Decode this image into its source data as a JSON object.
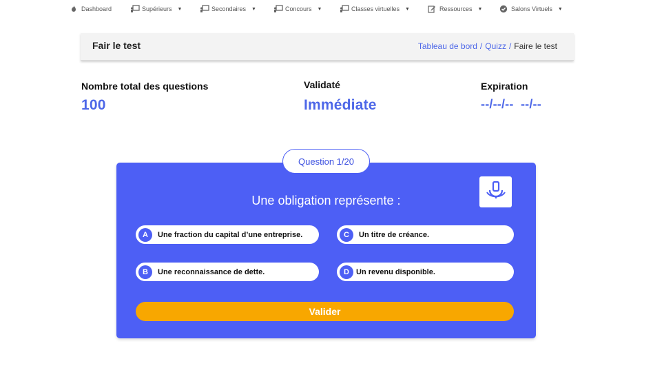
{
  "nav": {
    "items": [
      {
        "label": "Dashboard",
        "icon": "fire-icon",
        "has_caret": false
      },
      {
        "label": "Supérieurs",
        "icon": "presentation-icon",
        "has_caret": true
      },
      {
        "label": "Secondaires",
        "icon": "presentation-icon",
        "has_caret": true
      },
      {
        "label": "Concours",
        "icon": "presentation-icon",
        "has_caret": true
      },
      {
        "label": "Classes virtuelles",
        "icon": "presentation-icon",
        "has_caret": true
      },
      {
        "label": "Ressources",
        "icon": "edit-icon",
        "has_caret": true
      },
      {
        "label": "Salons Virtuels",
        "icon": "check-circle-icon",
        "has_caret": true
      }
    ]
  },
  "header": {
    "title": "Fair le test",
    "breadcrumb": {
      "link1": "Tableau de bord",
      "link2": "Quizz",
      "separator": "/",
      "current": "Faire le test"
    }
  },
  "stats": {
    "total": {
      "label": "Nombre total des questions",
      "value": "100"
    },
    "validity": {
      "label": "Validaté",
      "value": "Immédiate"
    },
    "expiration": {
      "label": "Expiration",
      "value": "--/--/--  --/--"
    }
  },
  "quiz": {
    "counter": "Question 1/20",
    "question": "Une obligation représente :",
    "options": [
      {
        "letter": "A",
        "text": "Une fraction du capital d’une entreprise."
      },
      {
        "letter": "B",
        "text": "Une reconnaissance de dette."
      },
      {
        "letter": "C",
        "text": "Un titre de créance."
      },
      {
        "letter": "D",
        "text": "Un revenu disponible."
      }
    ],
    "submit_label": "Valider"
  },
  "colors": {
    "accent": "#4d5ff5",
    "link": "#4d67e8",
    "submit": "#f8a700"
  }
}
